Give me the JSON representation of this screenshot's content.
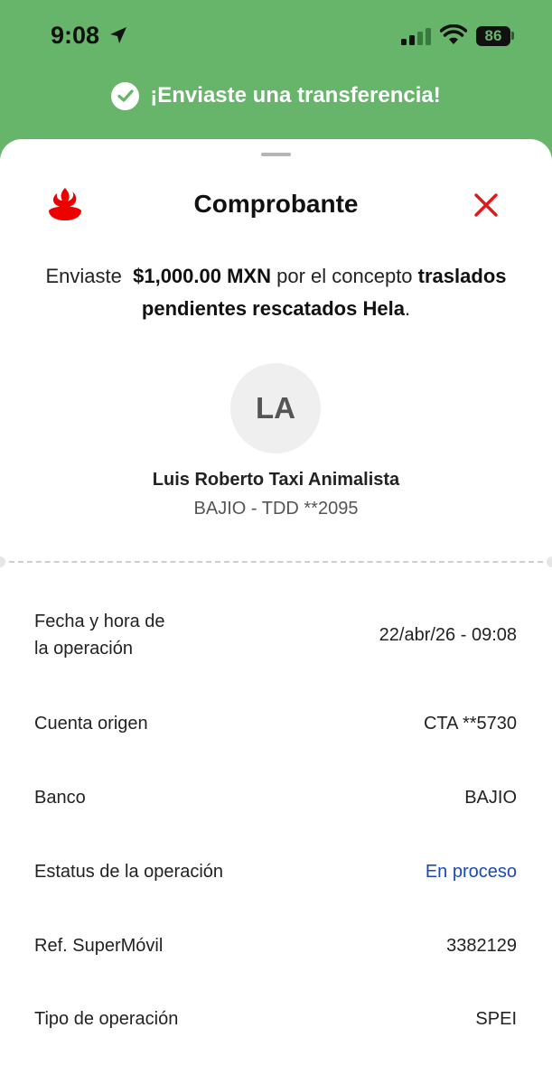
{
  "status_bar": {
    "time": "9:08",
    "battery": "86",
    "icons": [
      "location-arrow-icon",
      "cellular-signal-icon",
      "wifi-icon",
      "battery-icon"
    ]
  },
  "toast": {
    "text": "¡Enviaste una transferencia!",
    "icon": "check-circle-icon"
  },
  "sheet": {
    "title": "Comprobante",
    "logo": "santander-flame-logo",
    "close_icon": "close-icon",
    "summary": {
      "prefix": "Enviaste",
      "amount": "$1,000.00 MXN",
      "middle": "por el concepto",
      "concept": "traslados pendientes rescatados Hela",
      "suffix": "."
    },
    "recipient": {
      "initials": "LA",
      "name": "Luis Roberto Taxi Animalista",
      "account": "BAJIO - TDD **2095"
    },
    "details": {
      "fecha_label_line1": "Fecha y hora de",
      "fecha_label_line2": "la operación",
      "fecha_value": "22/abr/26 - 09:08",
      "cuenta_label": "Cuenta origen",
      "cuenta_value": "CTA **5730",
      "banco_label": "Banco",
      "banco_value": "BAJIO",
      "estatus_label": "Estatus de la operación",
      "estatus_value": "En proceso",
      "ref_label": "Ref. SuperMóvil",
      "ref_value": "3382129",
      "tipo_label": "Tipo de operación",
      "tipo_value": "SPEI"
    }
  },
  "colors": {
    "header_green": "#66b56b",
    "brand_red": "#ec0000",
    "link_blue": "#1a49b8"
  }
}
